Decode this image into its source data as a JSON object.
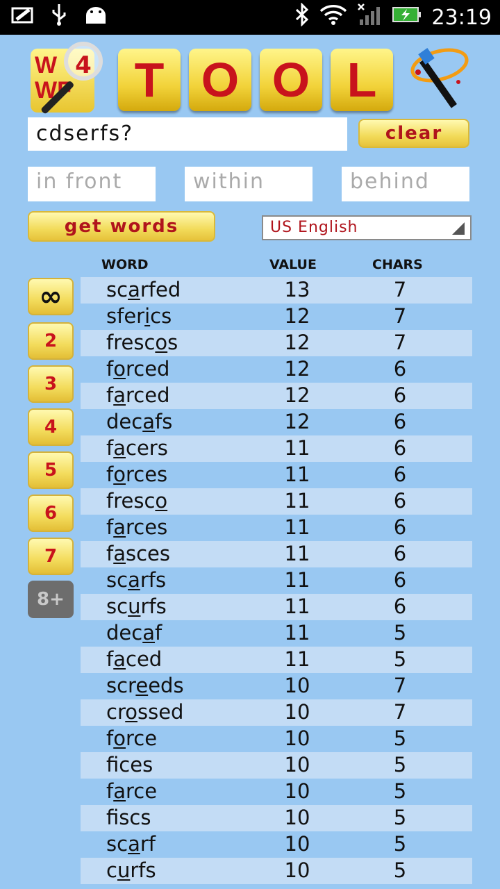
{
  "status_bar": {
    "time": "23:19",
    "icons": [
      "gallery-icon",
      "usb-icon",
      "android-icon",
      "bluetooth-icon",
      "wifi-icon",
      "signal-icon",
      "battery-icon"
    ]
  },
  "logo": {
    "title_letters": [
      "T",
      "O",
      "O",
      "L"
    ],
    "wwf_line1": "W",
    "wwf_line2": "WF",
    "magnifier_num": "4"
  },
  "search": {
    "value": "cdserfs?"
  },
  "clear_label": "clear",
  "positions": {
    "front": "in front",
    "within": "within",
    "behind": "behind"
  },
  "get_words_label": "get words",
  "language": "US English",
  "table": {
    "headers": {
      "word": "WORD",
      "value": "VALUE",
      "chars": "CHARS"
    },
    "rows": [
      {
        "pre": "sc",
        "u": "a",
        "post": "rfed",
        "value": "13",
        "chars": "7"
      },
      {
        "pre": "sfer",
        "u": "i",
        "post": "cs",
        "value": "12",
        "chars": "7"
      },
      {
        "pre": "fresc",
        "u": "o",
        "post": "s",
        "value": "12",
        "chars": "7"
      },
      {
        "pre": "f",
        "u": "o",
        "post": "rced",
        "value": "12",
        "chars": "6"
      },
      {
        "pre": "f",
        "u": "a",
        "post": "rced",
        "value": "12",
        "chars": "6"
      },
      {
        "pre": "dec",
        "u": "a",
        "post": "fs",
        "value": "12",
        "chars": "6"
      },
      {
        "pre": "f",
        "u": "a",
        "post": "cers",
        "value": "11",
        "chars": "6"
      },
      {
        "pre": "f",
        "u": "o",
        "post": "rces",
        "value": "11",
        "chars": "6"
      },
      {
        "pre": "fresc",
        "u": "o",
        "post": "",
        "value": "11",
        "chars": "6"
      },
      {
        "pre": "f",
        "u": "a",
        "post": "rces",
        "value": "11",
        "chars": "6"
      },
      {
        "pre": "f",
        "u": "a",
        "post": "sces",
        "value": "11",
        "chars": "6"
      },
      {
        "pre": "sc",
        "u": "a",
        "post": "rfs",
        "value": "11",
        "chars": "6"
      },
      {
        "pre": "sc",
        "u": "u",
        "post": "rfs",
        "value": "11",
        "chars": "6"
      },
      {
        "pre": "dec",
        "u": "a",
        "post": "f",
        "value": "11",
        "chars": "5"
      },
      {
        "pre": "f",
        "u": "a",
        "post": "ced",
        "value": "11",
        "chars": "5"
      },
      {
        "pre": "scr",
        "u": "e",
        "post": "eds",
        "value": "10",
        "chars": "7"
      },
      {
        "pre": "cr",
        "u": "o",
        "post": "ssed",
        "value": "10",
        "chars": "7"
      },
      {
        "pre": "f",
        "u": "o",
        "post": "rce",
        "value": "10",
        "chars": "5"
      },
      {
        "pre": "f",
        "u": "i",
        "post": "ces",
        "value": "10",
        "chars": "5"
      },
      {
        "pre": "f",
        "u": "a",
        "post": "rce",
        "value": "10",
        "chars": "5"
      },
      {
        "pre": "f",
        "u": "i",
        "post": "scs",
        "value": "10",
        "chars": "5"
      },
      {
        "pre": "sc",
        "u": "a",
        "post": "rf",
        "value": "10",
        "chars": "5"
      },
      {
        "pre": "c",
        "u": "u",
        "post": "rfs",
        "value": "10",
        "chars": "5"
      }
    ]
  },
  "length_filters": [
    "∞",
    "2",
    "3",
    "4",
    "5",
    "6",
    "7",
    "8+"
  ]
}
